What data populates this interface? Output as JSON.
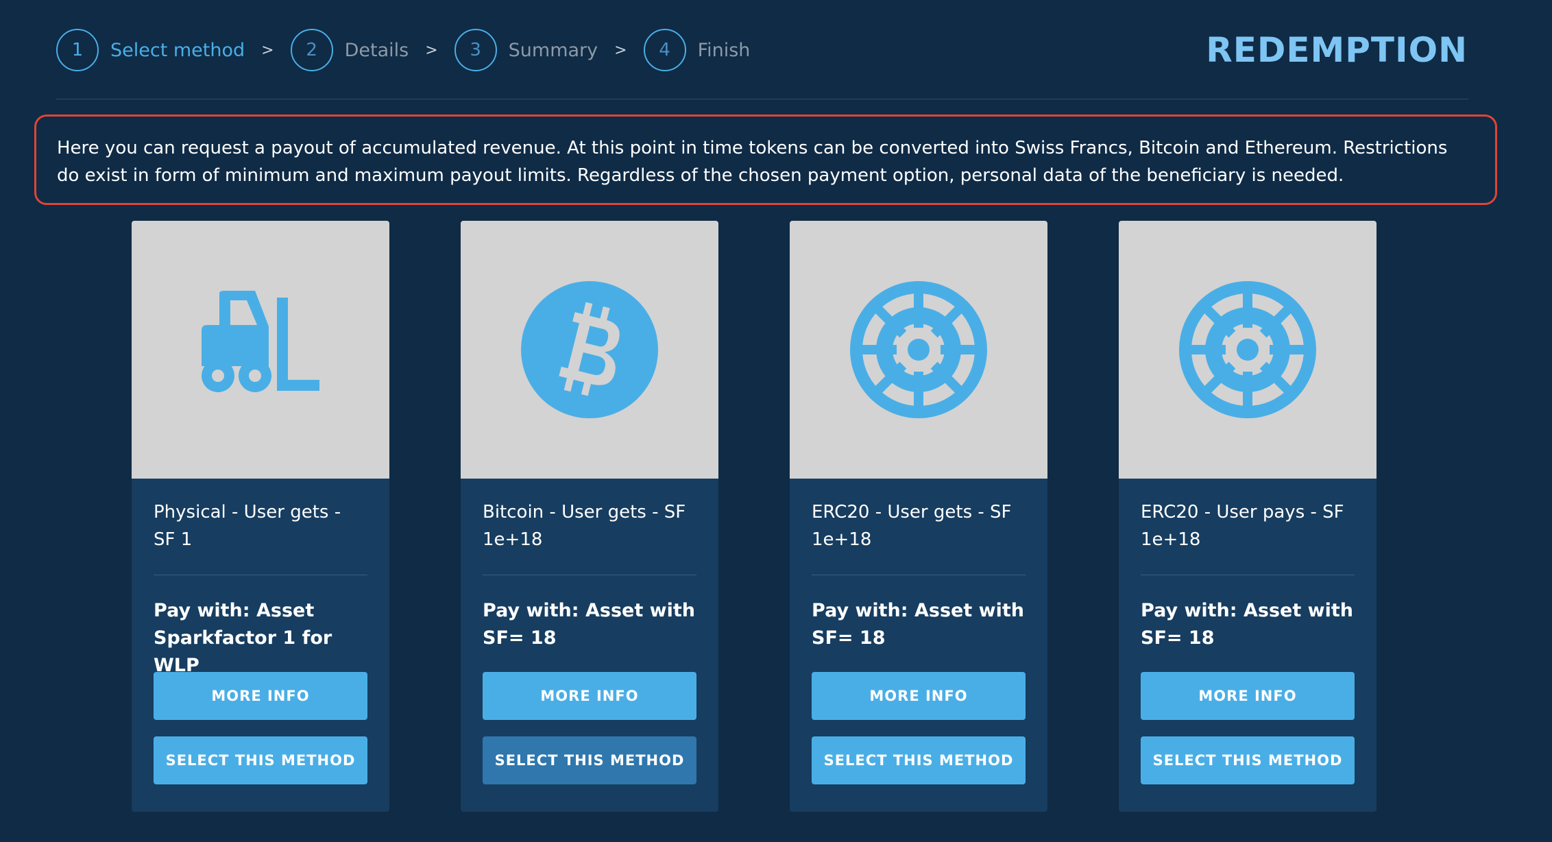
{
  "stepper": {
    "steps": [
      {
        "number": "1",
        "label": "Select method"
      },
      {
        "number": "2",
        "label": "Details"
      },
      {
        "number": "3",
        "label": "Summary"
      },
      {
        "number": "4",
        "label": "Finish"
      }
    ],
    "separator": ">"
  },
  "header": {
    "title": "REDEMPTION"
  },
  "intro": {
    "text": "Here you can request a payout of accumulated revenue. At this point in time tokens can be converted into Swiss Francs, Bitcoin and Ethereum. Restrictions do exist in form of minimum and maximum payout limits. Regardless of the chosen payment option, personal data of the beneficiary is needed."
  },
  "colors": {
    "background": "#0f2b46",
    "card": "#173d60",
    "accent": "#4aaee6",
    "highlight_border": "#e04434",
    "button_hover": "#2f77ad"
  },
  "cards": [
    {
      "icon": "forklift-icon",
      "title": "Physical - User gets - SF 1",
      "pay_with": "Pay with: Asset Sparkfactor 1 for WLP",
      "more_info_label": "MORE INFO",
      "select_label": "SELECT THIS METHOD"
    },
    {
      "icon": "bitcoin-icon",
      "title": "Bitcoin - User gets - SF 1e+18",
      "pay_with": "Pay with: Asset with SF= 18",
      "more_info_label": "MORE INFO",
      "select_label": "SELECT THIS METHOD"
    },
    {
      "icon": "erc20-icon",
      "title": "ERC20 - User gets - SF 1e+18",
      "pay_with": "Pay with: Asset with SF= 18",
      "more_info_label": "MORE INFO",
      "select_label": "SELECT THIS METHOD"
    },
    {
      "icon": "erc20-icon",
      "title": "ERC20 - User pays - SF 1e+18",
      "pay_with": "Pay with: Asset with SF= 18",
      "more_info_label": "MORE INFO",
      "select_label": "SELECT THIS METHOD"
    }
  ]
}
